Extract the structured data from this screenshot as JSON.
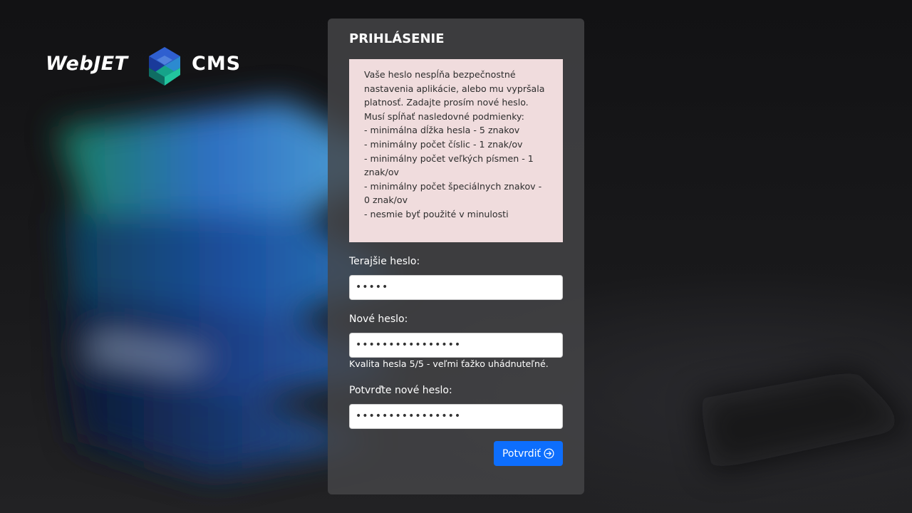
{
  "brand": {
    "logo_alt": "WebJET CMS",
    "logo_word_left": "WebJET",
    "logo_word_right": "CMS"
  },
  "panel": {
    "title": "PRIHLÁSENIE",
    "alert": {
      "intro": "Vaše heslo nespĺňa bezpečnostné nastavenia aplikácie, alebo mu vypršala platnosť. Zadajte prosím nové heslo. Musí spĺňať nasledovné podmienky:",
      "rules": [
        "- minimálna dĺžka hesla - 5 znakov",
        "- minimálny počet číslic - 1 znak/ov",
        "- minimálny počet veľkých písmen - 1 znak/ov",
        "- minimálny počet špeciálnych znakov - 0 znak/ov",
        "- nesmie byť použité v minulosti"
      ]
    },
    "fields": {
      "current": {
        "label": "Terajšie heslo:",
        "value": "•••••"
      },
      "new": {
        "label": "Nové heslo:",
        "value": "••••••••••••••••"
      },
      "confirm": {
        "label": "Potvrďte nové heslo:",
        "value": "••••••••••••••••"
      }
    },
    "password_quality": "Kvalita hesla 5/5 - veľmi ťažko uhádnuteľné.",
    "submit_label": "Potvrdiť",
    "submit_icon": "arrow-right-circle-icon"
  },
  "colors": {
    "primary_button": "#0d6efd",
    "alert_bg": "#f0dcdd",
    "panel_bg": "#464648"
  }
}
